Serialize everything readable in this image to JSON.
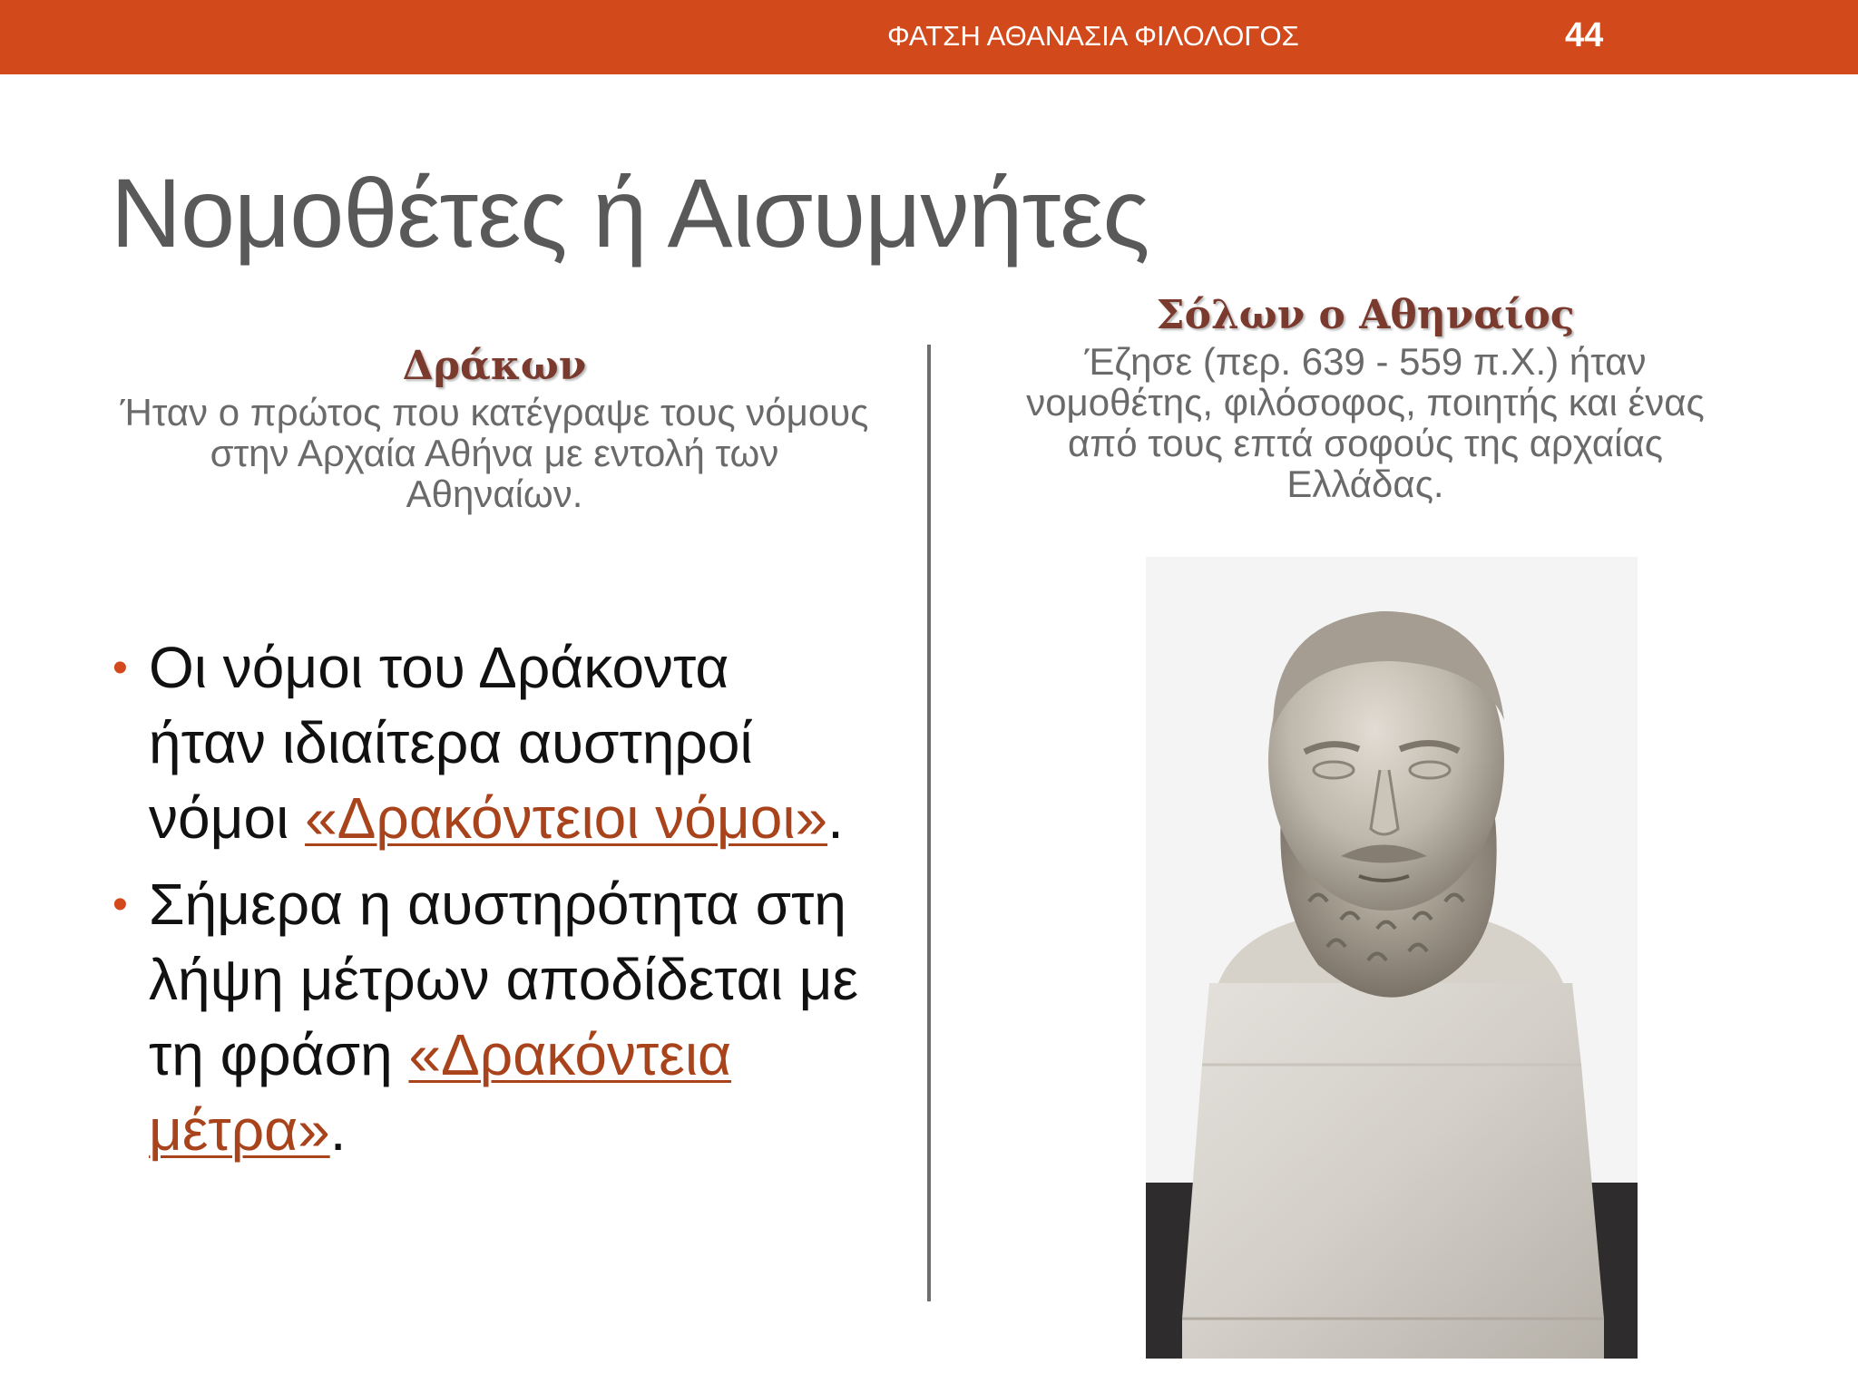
{
  "header": {
    "author": "ΦΑΤΣΗ ΑΘΑΝΑΣΙΑ ΦΙΛΟΛΟΓΟΣ",
    "page_number": "44"
  },
  "slide": {
    "title": "Νομοθέτες ή Αισυμνήτες"
  },
  "left": {
    "name": "Δράκων",
    "description": "Ήταν ο πρώτος που κατέγραψε τους νόμους στην Αρχαία Αθήνα με εντολή των Αθηναίων.",
    "bullets": [
      {
        "text_before": "Οι νόμοι του Δράκοντα ήταν ιδιαίτερα αυστηροί νόμοι ",
        "link": "«Δρακόντειοι νόμοι»",
        "text_after": "."
      },
      {
        "text_before": "Σήμερα η αυστηρότητα στη λήψη μέτρων αποδίδεται με τη φράση ",
        "link": "«Δρακόντεια μέτρα»",
        "text_after": "."
      }
    ]
  },
  "right": {
    "name": "Σόλων ο Αθηναίος",
    "description": "Έζησε (περ. 639 - 559 π.Χ.) ήταν νομοθέτης, φιλόσοφος, ποιητής και ένας από τους επτά σοφούς της αρχαίας Ελλάδας."
  },
  "colors": {
    "accent": "#d24a1c",
    "name_color": "#7b3a2e",
    "link_color": "#a8431c"
  }
}
